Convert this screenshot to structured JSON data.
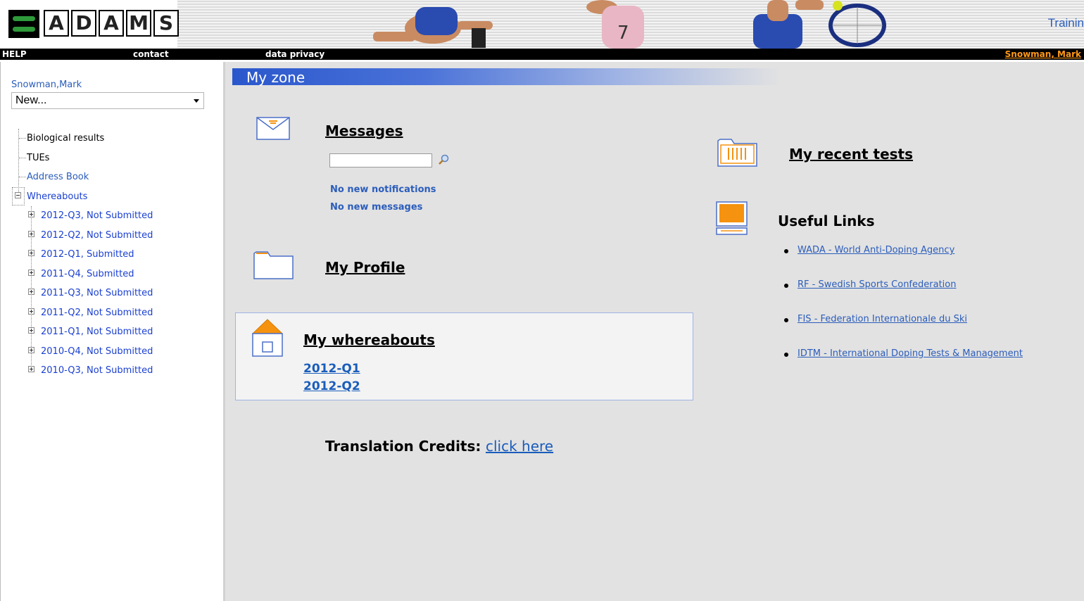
{
  "header": {
    "logo_text": "ADAMS",
    "training_label": "Trainin",
    "nav": {
      "help": "HELP",
      "contact": "contact",
      "data_privacy": "data privacy",
      "user": "Snowman, Mark"
    }
  },
  "sidebar": {
    "user_name": "Snowman,Mark",
    "new_select": {
      "value": "New..."
    },
    "items": [
      {
        "label": "Biological results"
      },
      {
        "label": "TUEs"
      },
      {
        "label": "Address Book"
      },
      {
        "label": "Whereabouts"
      }
    ],
    "whereabouts_children": [
      {
        "label": "2012-Q3, Not Submitted"
      },
      {
        "label": "2012-Q2, Not Submitted"
      },
      {
        "label": "2012-Q1, Submitted"
      },
      {
        "label": "2011-Q4, Submitted"
      },
      {
        "label": "2011-Q3, Not Submitted"
      },
      {
        "label": "2011-Q2, Not Submitted"
      },
      {
        "label": "2011-Q1, Not Submitted"
      },
      {
        "label": "2010-Q4, Not Submitted"
      },
      {
        "label": "2010-Q3, Not Submitted"
      }
    ]
  },
  "main": {
    "zone_title": "My zone",
    "messages": {
      "title": "Messages",
      "search_value": "",
      "no_notifications": "No new notifications",
      "no_messages": "No new messages"
    },
    "profile": {
      "title": "My Profile"
    },
    "whereabouts": {
      "title": "My whereabouts",
      "quarters": [
        "2012-Q1",
        "2012-Q2"
      ]
    },
    "recent_tests": {
      "title": "My recent tests"
    },
    "useful_links": {
      "title": "Useful Links",
      "links": [
        "WADA - World Anti-Doping Agency",
        "RF - Swedish Sports Confederation",
        "FIS - Federation Internationale du Ski",
        "IDTM - International Doping Tests & Management"
      ]
    },
    "credits": {
      "label": "Translation Credits:",
      "link": "click here"
    }
  },
  "colors": {
    "accent_blue": "#2a57cc",
    "link_blue": "#2b5dbb",
    "user_orange": "#ff9a1a",
    "icon_orange": "#f5920f"
  }
}
